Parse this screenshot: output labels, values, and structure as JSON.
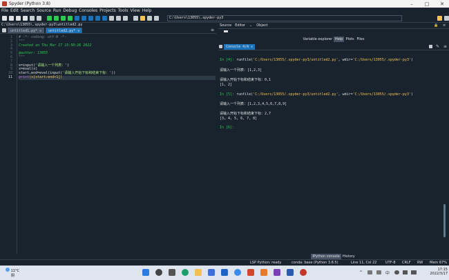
{
  "window": {
    "title": "Spyder (Python 3.8)"
  },
  "menu": [
    "File",
    "Edit",
    "Search",
    "Source",
    "Run",
    "Debug",
    "Consoles",
    "Projects",
    "Tools",
    "View",
    "Help"
  ],
  "toolbar": {
    "path": "C:\\Users\\13055\\.spyder-py3"
  },
  "editor": {
    "file_path": "C:\\Users\\13055\\.spyder-py3\\untitled2.py",
    "tabs": [
      {
        "label": "untitled1.py*",
        "active": false
      },
      {
        "label": "untitled2.py*",
        "active": true
      }
    ],
    "line_numbers": [
      "1",
      "2",
      "3",
      "4",
      "5",
      "6",
      "7",
      "8",
      "9",
      "10",
      "11"
    ],
    "lines": {
      "l1": "# -*- coding: utf-8 -*-",
      "l2": "\"\"\"",
      "l3": "Created on Thu Mar 17 15:58:26 2022",
      "l5": "@author: 13055",
      "l6": "\"\"\"",
      "l8_a": "x=input(",
      "l8_b": "'请输入一个列表：'",
      "l8_c": ")",
      "l9": "x=eval(x)",
      "l10_a": "start,end=eval(input(",
      "l10_b": "'请输入开始下标和结束下标：'",
      "l10_c": "))",
      "l11_a": "print",
      "l11_b": "(x[start:end+1])"
    }
  },
  "help_pane": {
    "tabs": {
      "source": "Source",
      "editor": "Editor",
      "object": "Object"
    },
    "pane_tabs": [
      "Variable explorer",
      "Help",
      "Plots",
      "Files"
    ],
    "active_pane_tab": "Help"
  },
  "console": {
    "tab_label": "Console 4/A",
    "blocks": [
      {
        "prompt": "In [4]:",
        "cmd_a": " runfile(",
        "path_a": "'C:/Users/13055/.spyder-py3/untitled2.py'",
        "cmd_b": ", wdir=",
        "path_b": "'C:/Users/13055/.spyder-py3'",
        "cmd_c": ")",
        "line1": "请输入一个列表：[1,2,3]",
        "line2": "请输入开始下标和结束下标：0,1",
        "out": "[1, 2]"
      },
      {
        "prompt": "In [5]:",
        "cmd_a": " runfile(",
        "path_a": "'C:/Users/13055/.spyder-py3/untitled2.py'",
        "cmd_b": ", wdir=",
        "path_b": "'C:/Users/13055/.spyder-py3'",
        "cmd_c": ")",
        "line1": "请输入一个列表：[1,2,3,4,5,6,7,8,9]",
        "line2": "请输入开始下标和结束下标：2,7",
        "out": "[3, 4, 5, 6, 7, 8]"
      }
    ],
    "next_prompt": "In [6]:",
    "bottom_tabs": [
      "IPython console",
      "History"
    ],
    "active_bottom_tab": "IPython console"
  },
  "statusbar": {
    "lsp": "LSP Python: ready",
    "conda": "conda: base (Python 3.8.5)",
    "position": "Line 11, Col 22",
    "encoding": "UTF-8",
    "eol": "CRLF",
    "perm": "RW",
    "mem": "Mem 67%"
  },
  "taskbar": {
    "weather_temp": "11°C",
    "weather_cond": "阴",
    "time": "17:15",
    "date": "2022/3/17"
  },
  "colors": {
    "accent": "#1a72bb",
    "background": "#19232d",
    "prompt": "#2dca4f",
    "string": "#f7c453"
  }
}
